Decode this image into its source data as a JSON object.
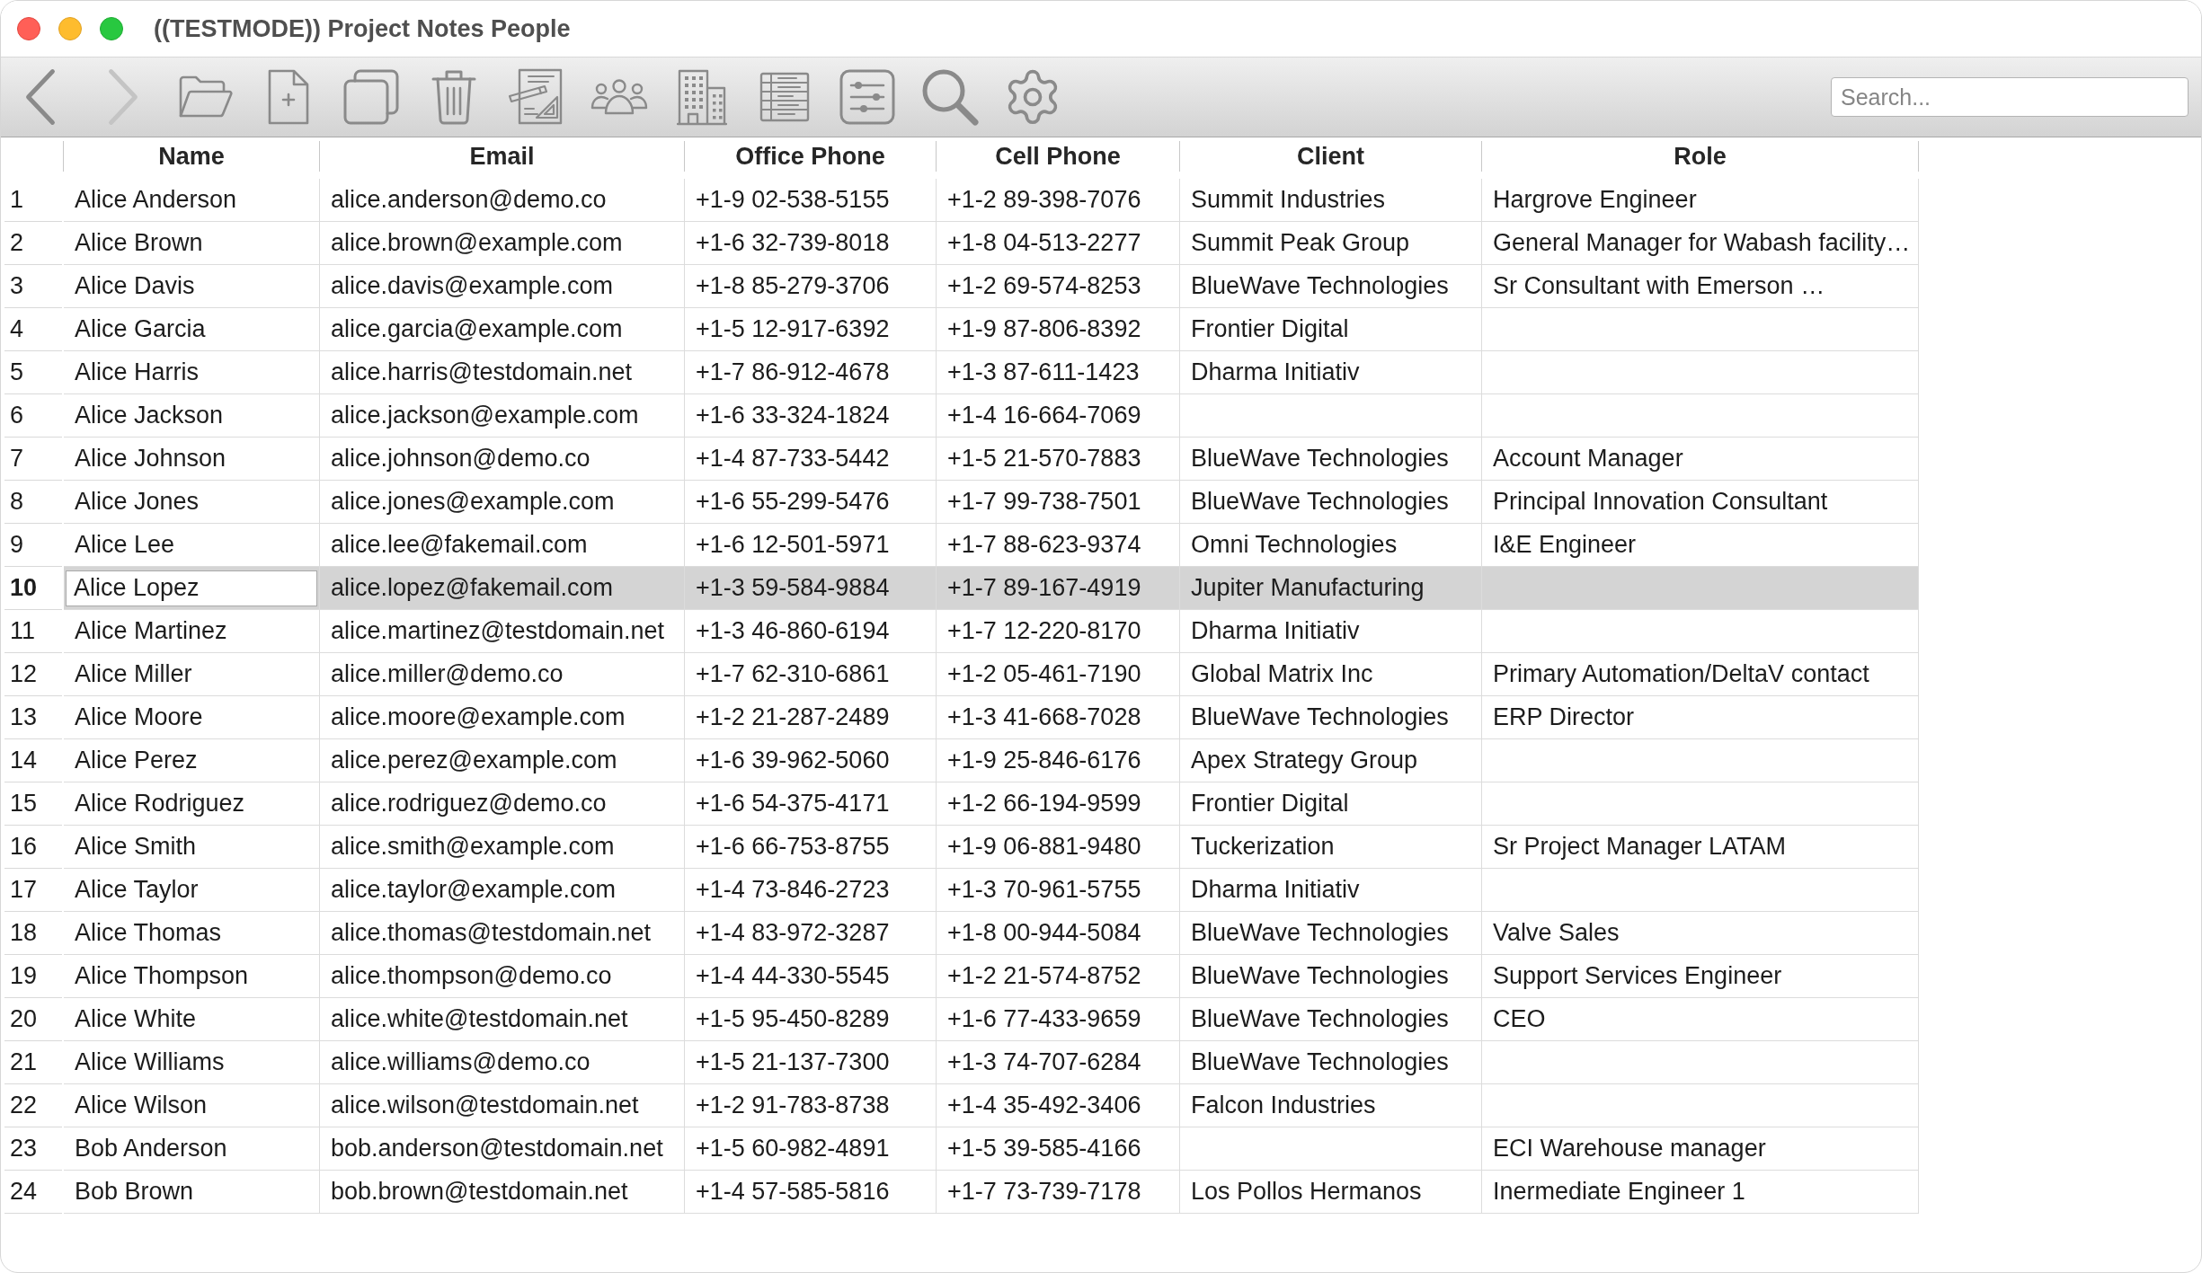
{
  "window": {
    "title": "((TESTMODE)) Project Notes People"
  },
  "toolbar": {
    "buttons": [
      {
        "disabled": false
      },
      {
        "disabled": true
      },
      {
        "disabled": false
      },
      {
        "disabled": false
      },
      {
        "disabled": false
      },
      {
        "disabled": false
      },
      {
        "disabled": false
      },
      {
        "disabled": false
      },
      {
        "disabled": false
      },
      {
        "disabled": false
      },
      {
        "disabled": false
      },
      {
        "disabled": false
      },
      {
        "disabled": false
      }
    ],
    "search": {
      "placeholder": "Search..."
    }
  },
  "table": {
    "columns": [
      "Name",
      "Email",
      "Office Phone",
      "Cell Phone",
      "Client",
      "Role"
    ],
    "rows": [
      {
        "number": "1",
        "name": "Alice Anderson",
        "email": "alice.anderson@demo.co",
        "office_phone": "+1-9 02-538-5155",
        "cell_phone": "+1-2 89-398-7076",
        "client": "Summit Industries",
        "role": "Hargrove Engineer",
        "selected": false,
        "editing": false
      },
      {
        "number": "2",
        "name": "Alice Brown",
        "email": "alice.brown@example.com",
        "office_phone": "+1-6 32-739-8018",
        "cell_phone": "+1-8 04-513-2277",
        "client": "Summit Peak Group",
        "role": "General Manager for Wabash facility…",
        "selected": false,
        "editing": false
      },
      {
        "number": "3",
        "name": "Alice Davis",
        "email": "alice.davis@example.com",
        "office_phone": "+1-8 85-279-3706",
        "cell_phone": "+1-2 69-574-8253",
        "client": "BlueWave Technologies",
        "role": "Sr Consultant with Emerson …",
        "selected": false,
        "editing": false
      },
      {
        "number": "4",
        "name": "Alice Garcia",
        "email": "alice.garcia@example.com",
        "office_phone": "+1-5 12-917-6392",
        "cell_phone": "+1-9 87-806-8392",
        "client": "Frontier Digital",
        "selected": false,
        "editing": false
      },
      {
        "number": "5",
        "name": "Alice Harris",
        "email": "alice.harris@testdomain.net",
        "office_phone": "+1-7 86-912-4678",
        "cell_phone": "+1-3 87-611-1423",
        "client": "Dharma Initiativ",
        "selected": false,
        "editing": false
      },
      {
        "number": "6",
        "name": "Alice Jackson",
        "email": "alice.jackson@example.com",
        "office_phone": "+1-6 33-324-1824",
        "cell_phone": "+1-4 16-664-7069",
        "selected": false,
        "editing": false
      },
      {
        "number": "7",
        "name": "Alice Johnson",
        "email": "alice.johnson@demo.co",
        "office_phone": "+1-4 87-733-5442",
        "cell_phone": "+1-5 21-570-7883",
        "client": "BlueWave Technologies",
        "role": "Account Manager",
        "selected": false,
        "editing": false
      },
      {
        "number": "8",
        "name": "Alice Jones",
        "email": "alice.jones@example.com",
        "office_phone": "+1-6 55-299-5476",
        "cell_phone": "+1-7 99-738-7501",
        "client": "BlueWave Technologies",
        "role": "Principal Innovation Consultant",
        "selected": false,
        "editing": false
      },
      {
        "number": "9",
        "name": "Alice Lee",
        "email": "alice.lee@fakemail.com",
        "office_phone": "+1-6 12-501-5971",
        "cell_phone": "+1-7 88-623-9374",
        "client": "Omni Technologies",
        "role": "I&E Engineer",
        "selected": false,
        "editing": false
      },
      {
        "number": "10",
        "name": "Alice Lopez",
        "email": "alice.lopez@fakemail.com",
        "office_phone": "+1-3 59-584-9884",
        "cell_phone": "+1-7 89-167-4919",
        "client": "Jupiter Manufacturing",
        "selected": true,
        "editing": true
      },
      {
        "number": "11",
        "name": "Alice Martinez",
        "email": "alice.martinez@testdomain.net",
        "office_phone": "+1-3 46-860-6194",
        "cell_phone": "+1-7 12-220-8170",
        "client": "Dharma Initiativ",
        "selected": false,
        "editing": false
      },
      {
        "number": "12",
        "name": "Alice Miller",
        "email": "alice.miller@demo.co",
        "office_phone": "+1-7 62-310-6861",
        "cell_phone": "+1-2 05-461-7190",
        "client": "Global Matrix Inc",
        "role": "Primary Automation/DeltaV contact",
        "selected": false,
        "editing": false
      },
      {
        "number": "13",
        "name": "Alice Moore",
        "email": "alice.moore@example.com",
        "office_phone": "+1-2 21-287-2489",
        "cell_phone": "+1-3 41-668-7028",
        "client": "BlueWave Technologies",
        "role": "ERP Director",
        "selected": false,
        "editing": false
      },
      {
        "number": "14",
        "name": "Alice Perez",
        "email": "alice.perez@example.com",
        "office_phone": "+1-6 39-962-5060",
        "cell_phone": "+1-9 25-846-6176",
        "client": "Apex Strategy Group",
        "selected": false,
        "editing": false
      },
      {
        "number": "15",
        "name": "Alice Rodriguez",
        "email": "alice.rodriguez@demo.co",
        "office_phone": "+1-6 54-375-4171",
        "cell_phone": "+1-2 66-194-9599",
        "client": "Frontier Digital",
        "selected": false,
        "editing": false
      },
      {
        "number": "16",
        "name": "Alice Smith",
        "email": "alice.smith@example.com",
        "office_phone": "+1-6 66-753-8755",
        "cell_phone": "+1-9 06-881-9480",
        "client": "Tuckerization",
        "role": "Sr Project Manager LATAM",
        "selected": false,
        "editing": false
      },
      {
        "number": "17",
        "name": "Alice Taylor",
        "email": "alice.taylor@example.com",
        "office_phone": "+1-4 73-846-2723",
        "cell_phone": "+1-3 70-961-5755",
        "client": "Dharma Initiativ",
        "selected": false,
        "editing": false
      },
      {
        "number": "18",
        "name": "Alice Thomas",
        "email": "alice.thomas@testdomain.net",
        "office_phone": "+1-4 83-972-3287",
        "cell_phone": "+1-8 00-944-5084",
        "client": "BlueWave Technologies",
        "role": "Valve Sales",
        "selected": false,
        "editing": false
      },
      {
        "number": "19",
        "name": "Alice Thompson",
        "email": "alice.thompson@demo.co",
        "office_phone": "+1-4 44-330-5545",
        "cell_phone": "+1-2 21-574-8752",
        "client": "BlueWave Technologies",
        "role": "Support Services Engineer",
        "selected": false,
        "editing": false
      },
      {
        "number": "20",
        "name": "Alice White",
        "email": "alice.white@testdomain.net",
        "office_phone": "+1-5 95-450-8289",
        "cell_phone": "+1-6 77-433-9659",
        "client": "BlueWave Technologies",
        "role": "CEO",
        "selected": false,
        "editing": false
      },
      {
        "number": "21",
        "name": "Alice Williams",
        "email": "alice.williams@demo.co",
        "office_phone": "+1-5 21-137-7300",
        "cell_phone": "+1-3 74-707-6284",
        "client": "BlueWave Technologies",
        "selected": false,
        "editing": false
      },
      {
        "number": "22",
        "name": "Alice Wilson",
        "email": "alice.wilson@testdomain.net",
        "office_phone": "+1-2 91-783-8738",
        "cell_phone": "+1-4 35-492-3406",
        "client": "Falcon Industries",
        "selected": false,
        "editing": false
      },
      {
        "number": "23",
        "name": "Bob Anderson",
        "email": "bob.anderson@testdomain.net",
        "office_phone": "+1-5 60-982-4891",
        "cell_phone": "+1-5 39-585-4166",
        "role": "ECI Warehouse manager",
        "selected": false,
        "editing": false
      },
      {
        "number": "24",
        "name": "Bob Brown",
        "email": "bob.brown@testdomain.net",
        "office_phone": "+1-4 57-585-5816",
        "cell_phone": "+1-7 73-739-7178",
        "client": "Los Pollos Hermanos",
        "role": "Inermediate Engineer 1",
        "selected": false,
        "editing": false
      }
    ]
  }
}
